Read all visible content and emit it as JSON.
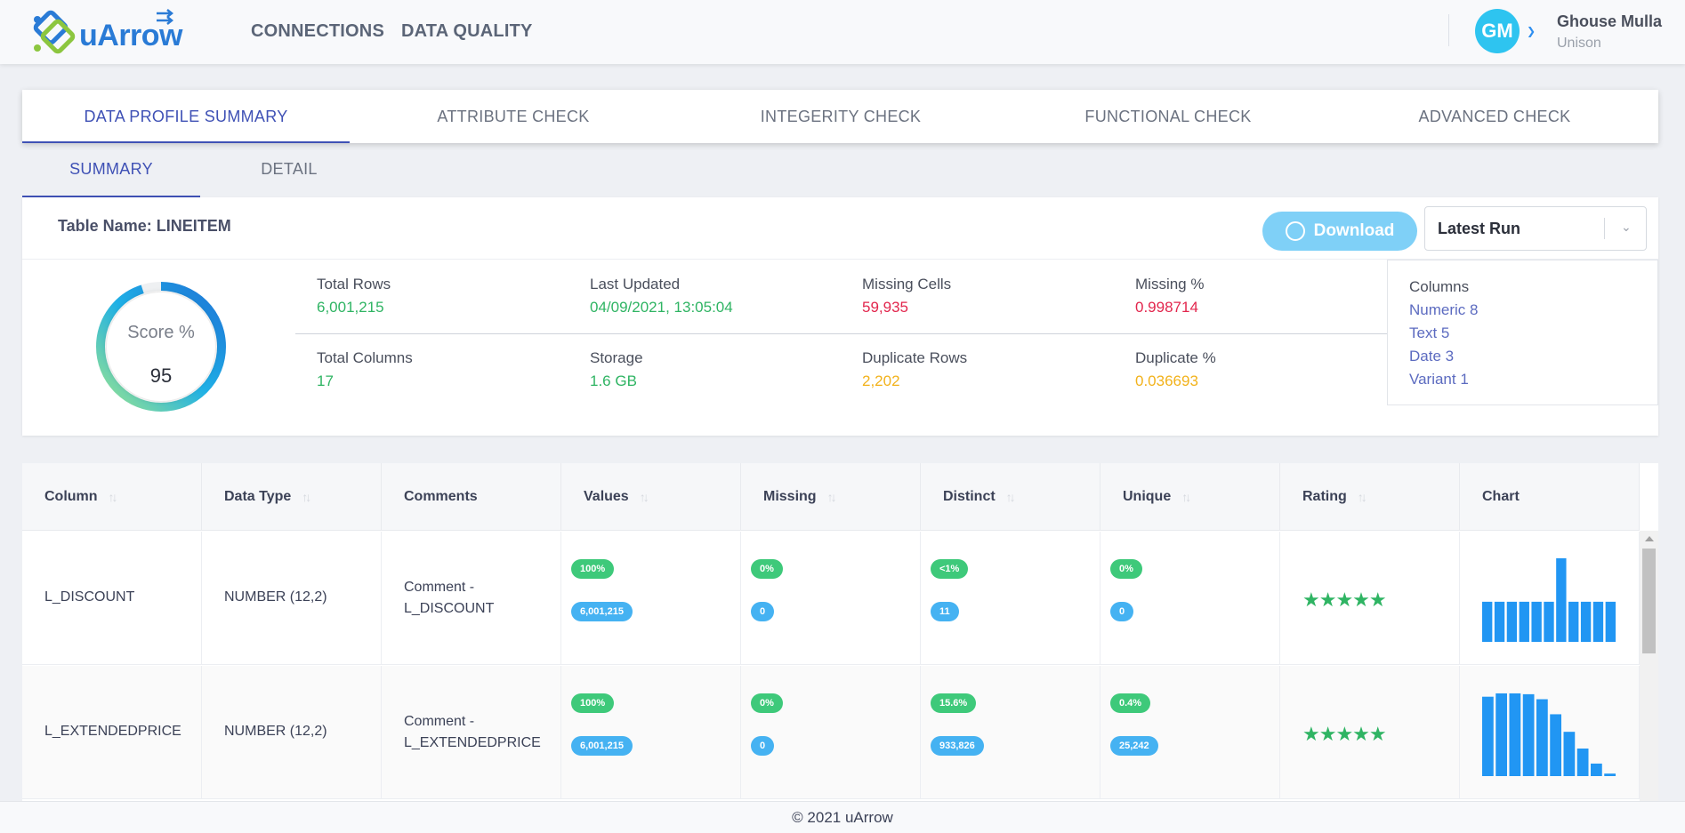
{
  "header": {
    "logo_text": "uArrow",
    "nav": [
      "CONNECTIONS",
      "DATA QUALITY"
    ],
    "user": {
      "initials": "GM",
      "name": "Ghouse Mulla",
      "org": "Unison"
    }
  },
  "tabs": [
    "DATA PROFILE SUMMARY",
    "ATTRIBUTE CHECK",
    "INTEGERITY CHECK",
    "FUNCTIONAL CHECK",
    "ADVANCED CHECK"
  ],
  "active_tab": 0,
  "subtabs": [
    "SUMMARY",
    "DETAIL"
  ],
  "summary": {
    "table_name": "Table Name: LINEITEM",
    "download_label": "Download",
    "run_select": "Latest Run",
    "score_label": "Score %",
    "score_value": "95",
    "score_fraction": 0.95,
    "metrics": [
      {
        "label": "Total Rows",
        "value": "6,001,215",
        "color": "#2fb463"
      },
      {
        "label": "Last Updated",
        "value": "04/09/2021, 13:05:04",
        "color": "#2fb463"
      },
      {
        "label": "Missing Cells",
        "value": "59,935",
        "color": "#e2264d"
      },
      {
        "label": "Missing %",
        "value": "0.998714",
        "color": "#e2264d"
      },
      {
        "label": "Total Columns",
        "value": "17",
        "color": "#2fb463"
      },
      {
        "label": "Storage",
        "value": "1.6 GB",
        "color": "#2fb463"
      },
      {
        "label": "Duplicate Rows",
        "value": "2,202",
        "color": "#f2b21b"
      },
      {
        "label": "Duplicate %",
        "value": "0.036693",
        "color": "#f2b21b"
      }
    ],
    "columns_title": "Columns",
    "column_types": [
      "Numeric 8",
      "Text 5",
      "Date 3",
      "Variant 1"
    ]
  },
  "table": {
    "headers": [
      "Column",
      "Data Type",
      "Comments",
      "Values",
      "Missing",
      "Distinct",
      "Unique",
      "Rating",
      "Chart"
    ],
    "rows": [
      {
        "column": "L_DISCOUNT",
        "type": "NUMBER (12,2)",
        "comment_1": "Comment -",
        "comment_2": "L_DISCOUNT",
        "values_pct": "100%",
        "values_cnt": "6,001,215",
        "missing_pct": "0%",
        "missing_cnt": "0",
        "distinct_pct": "<1%",
        "distinct_cnt": "11",
        "unique_pct": "0%",
        "unique_cnt": "0",
        "rating": "★★★★★",
        "rating_value": 5,
        "histogram": [
          48,
          48,
          48,
          48,
          48,
          48,
          100,
          48,
          48,
          48,
          48
        ]
      },
      {
        "column": "L_EXTENDEDPRICE",
        "type": "NUMBER (12,2)",
        "comment_1": "Comment -",
        "comment_2": "L_EXTENDEDPRICE",
        "values_pct": "100%",
        "values_cnt": "6,001,215",
        "missing_pct": "0%",
        "missing_cnt": "0",
        "distinct_pct": "15.6%",
        "distinct_cnt": "933,826",
        "unique_pct": "0.4%",
        "unique_cnt": "25,242",
        "rating": "★★★★★",
        "rating_value": 5,
        "histogram": [
          95,
          99,
          99,
          98,
          92,
          74,
          53,
          33,
          15,
          3
        ]
      }
    ]
  },
  "footer": "© 2021 uArrow"
}
